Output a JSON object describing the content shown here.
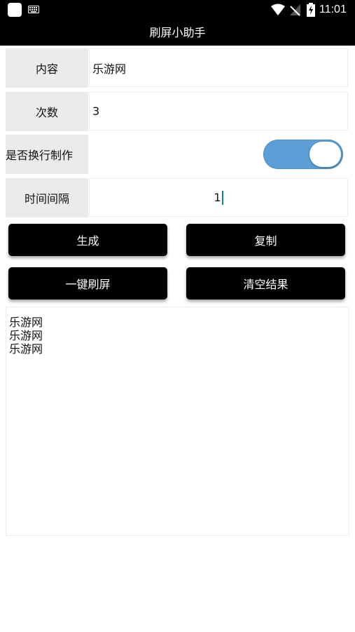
{
  "status_bar": {
    "time": "11:01",
    "icons": [
      "app-icon",
      "keyboard-icon",
      "wifi-icon",
      "no-signal-icon",
      "battery-charging-icon"
    ]
  },
  "app": {
    "title": "刷屏小助手"
  },
  "form": {
    "content_label": "内容",
    "content_value": "乐游网",
    "count_label": "次数",
    "count_value": "3",
    "newline_label": "是否换行制作",
    "newline_enabled": true,
    "interval_label": "时间间隔",
    "interval_value": "1"
  },
  "buttons": {
    "generate": "生成",
    "copy": "复制",
    "one_click": "一键刷屏",
    "clear": "清空结果"
  },
  "result": {
    "lines": [
      "乐游网",
      "乐游网",
      "乐游网"
    ]
  },
  "colors": {
    "bar": "#000000",
    "toggle_on": "#5b9fd6",
    "label_bg": "#ebebeb",
    "cursor": "#0a8a7a"
  }
}
